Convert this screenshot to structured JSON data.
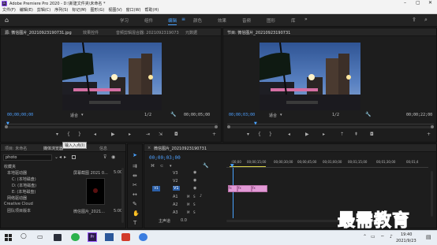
{
  "window": {
    "title": "Adobe Premiere Pro 2020 - D:\\新建文件夹\\未命名 *"
  },
  "menu": [
    "文件(F)",
    "编辑(E)",
    "剪辑(C)",
    "序列(S)",
    "标记(M)",
    "图形(G)",
    "视图(V)",
    "窗口(W)",
    "帮助(H)"
  ],
  "workspaces": [
    "学习",
    "组件",
    "编辑",
    "颜色",
    "效果",
    "音频",
    "图形",
    "库"
  ],
  "workspace_active": "编辑",
  "source_panel": {
    "tabs": [
      "源: 微信图片_20210923190731.jpg",
      "效果控件",
      "音频剪辑混合器: 2021092319073",
      "元数据"
    ],
    "timecode_in": "00;00;00;00",
    "fit": "适合",
    "ratio": "1/2",
    "timecode_out": "00;00;05;00"
  },
  "program_panel": {
    "tab": "节目: 微信图片_20210923190731",
    "timecode_in": "00;00;03;00",
    "fit": "适合",
    "ratio": "1/2",
    "timecode_out": "00;00;22;00"
  },
  "project_panel": {
    "tabs": [
      "项目: 未命名",
      "媒体浏览器",
      "信息"
    ],
    "search": "photo",
    "tree": [
      "收藏夹",
      "本地驱动器",
      "C: (本地磁盘)",
      "D: (本地磁盘)",
      "E: (本地磁盘)",
      "网络驱动器",
      "Creative Cloud",
      "团队项目版本"
    ],
    "thumbs": [
      {
        "name": "屏幕截图 2021 0...",
        "duration": "5:00"
      },
      {
        "name": "微信图片_2021...",
        "duration": "5:00"
      }
    ],
    "tooltip": "输入入点(I)"
  },
  "timeline": {
    "tab": "微信图片_20210923190731",
    "timecode": "00;00;03;00",
    "ruler": [
      ":00;00",
      "00;00;15;00",
      "00;00;30;00",
      "00;00;45;00",
      "00;01;00;00",
      "00;01;15;00",
      "00;01;30;00",
      "00;01;4"
    ],
    "tracks": [
      "V3",
      "V2",
      "V1",
      "A1",
      "A2",
      "A3"
    ],
    "master": "主声道",
    "master_value": "0.0",
    "clip_fx": [
      "fx",
      "fx",
      "fx"
    ]
  },
  "taskbar": {
    "time": "19:40",
    "date": "2021/9/23"
  },
  "watermark": "最需教育",
  "colors": {
    "accent": "#4aa3ff",
    "clip": "#e29ad6",
    "timecode": "#4da0ff"
  }
}
